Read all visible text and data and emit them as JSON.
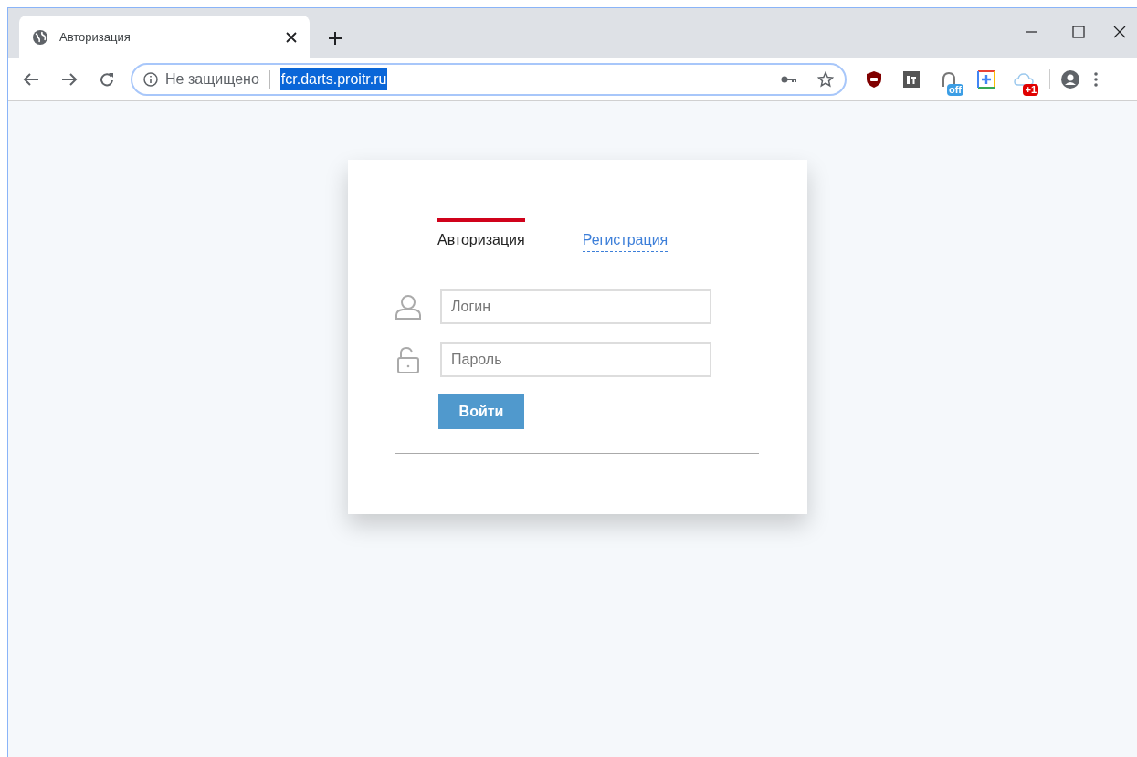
{
  "browser": {
    "tab_title": "Авторизация",
    "security_label": "Не защищено",
    "url": "fcr.darts.proitr.ru",
    "extensions": [
      {
        "kind": "shield"
      },
      {
        "kind": "et"
      },
      {
        "kind": "arc",
        "badge": "off"
      },
      {
        "kind": "plus"
      },
      {
        "kind": "cloud",
        "badge": "+1"
      }
    ]
  },
  "login_card": {
    "tabs": [
      {
        "label": "Авторизация",
        "selected": true
      },
      {
        "label": "Регистрация",
        "selected": false
      }
    ],
    "fields": [
      {
        "kind": "user",
        "placeholder": "Логин"
      },
      {
        "kind": "lock",
        "placeholder": "Пароль"
      }
    ],
    "submit_button": "Войти"
  }
}
